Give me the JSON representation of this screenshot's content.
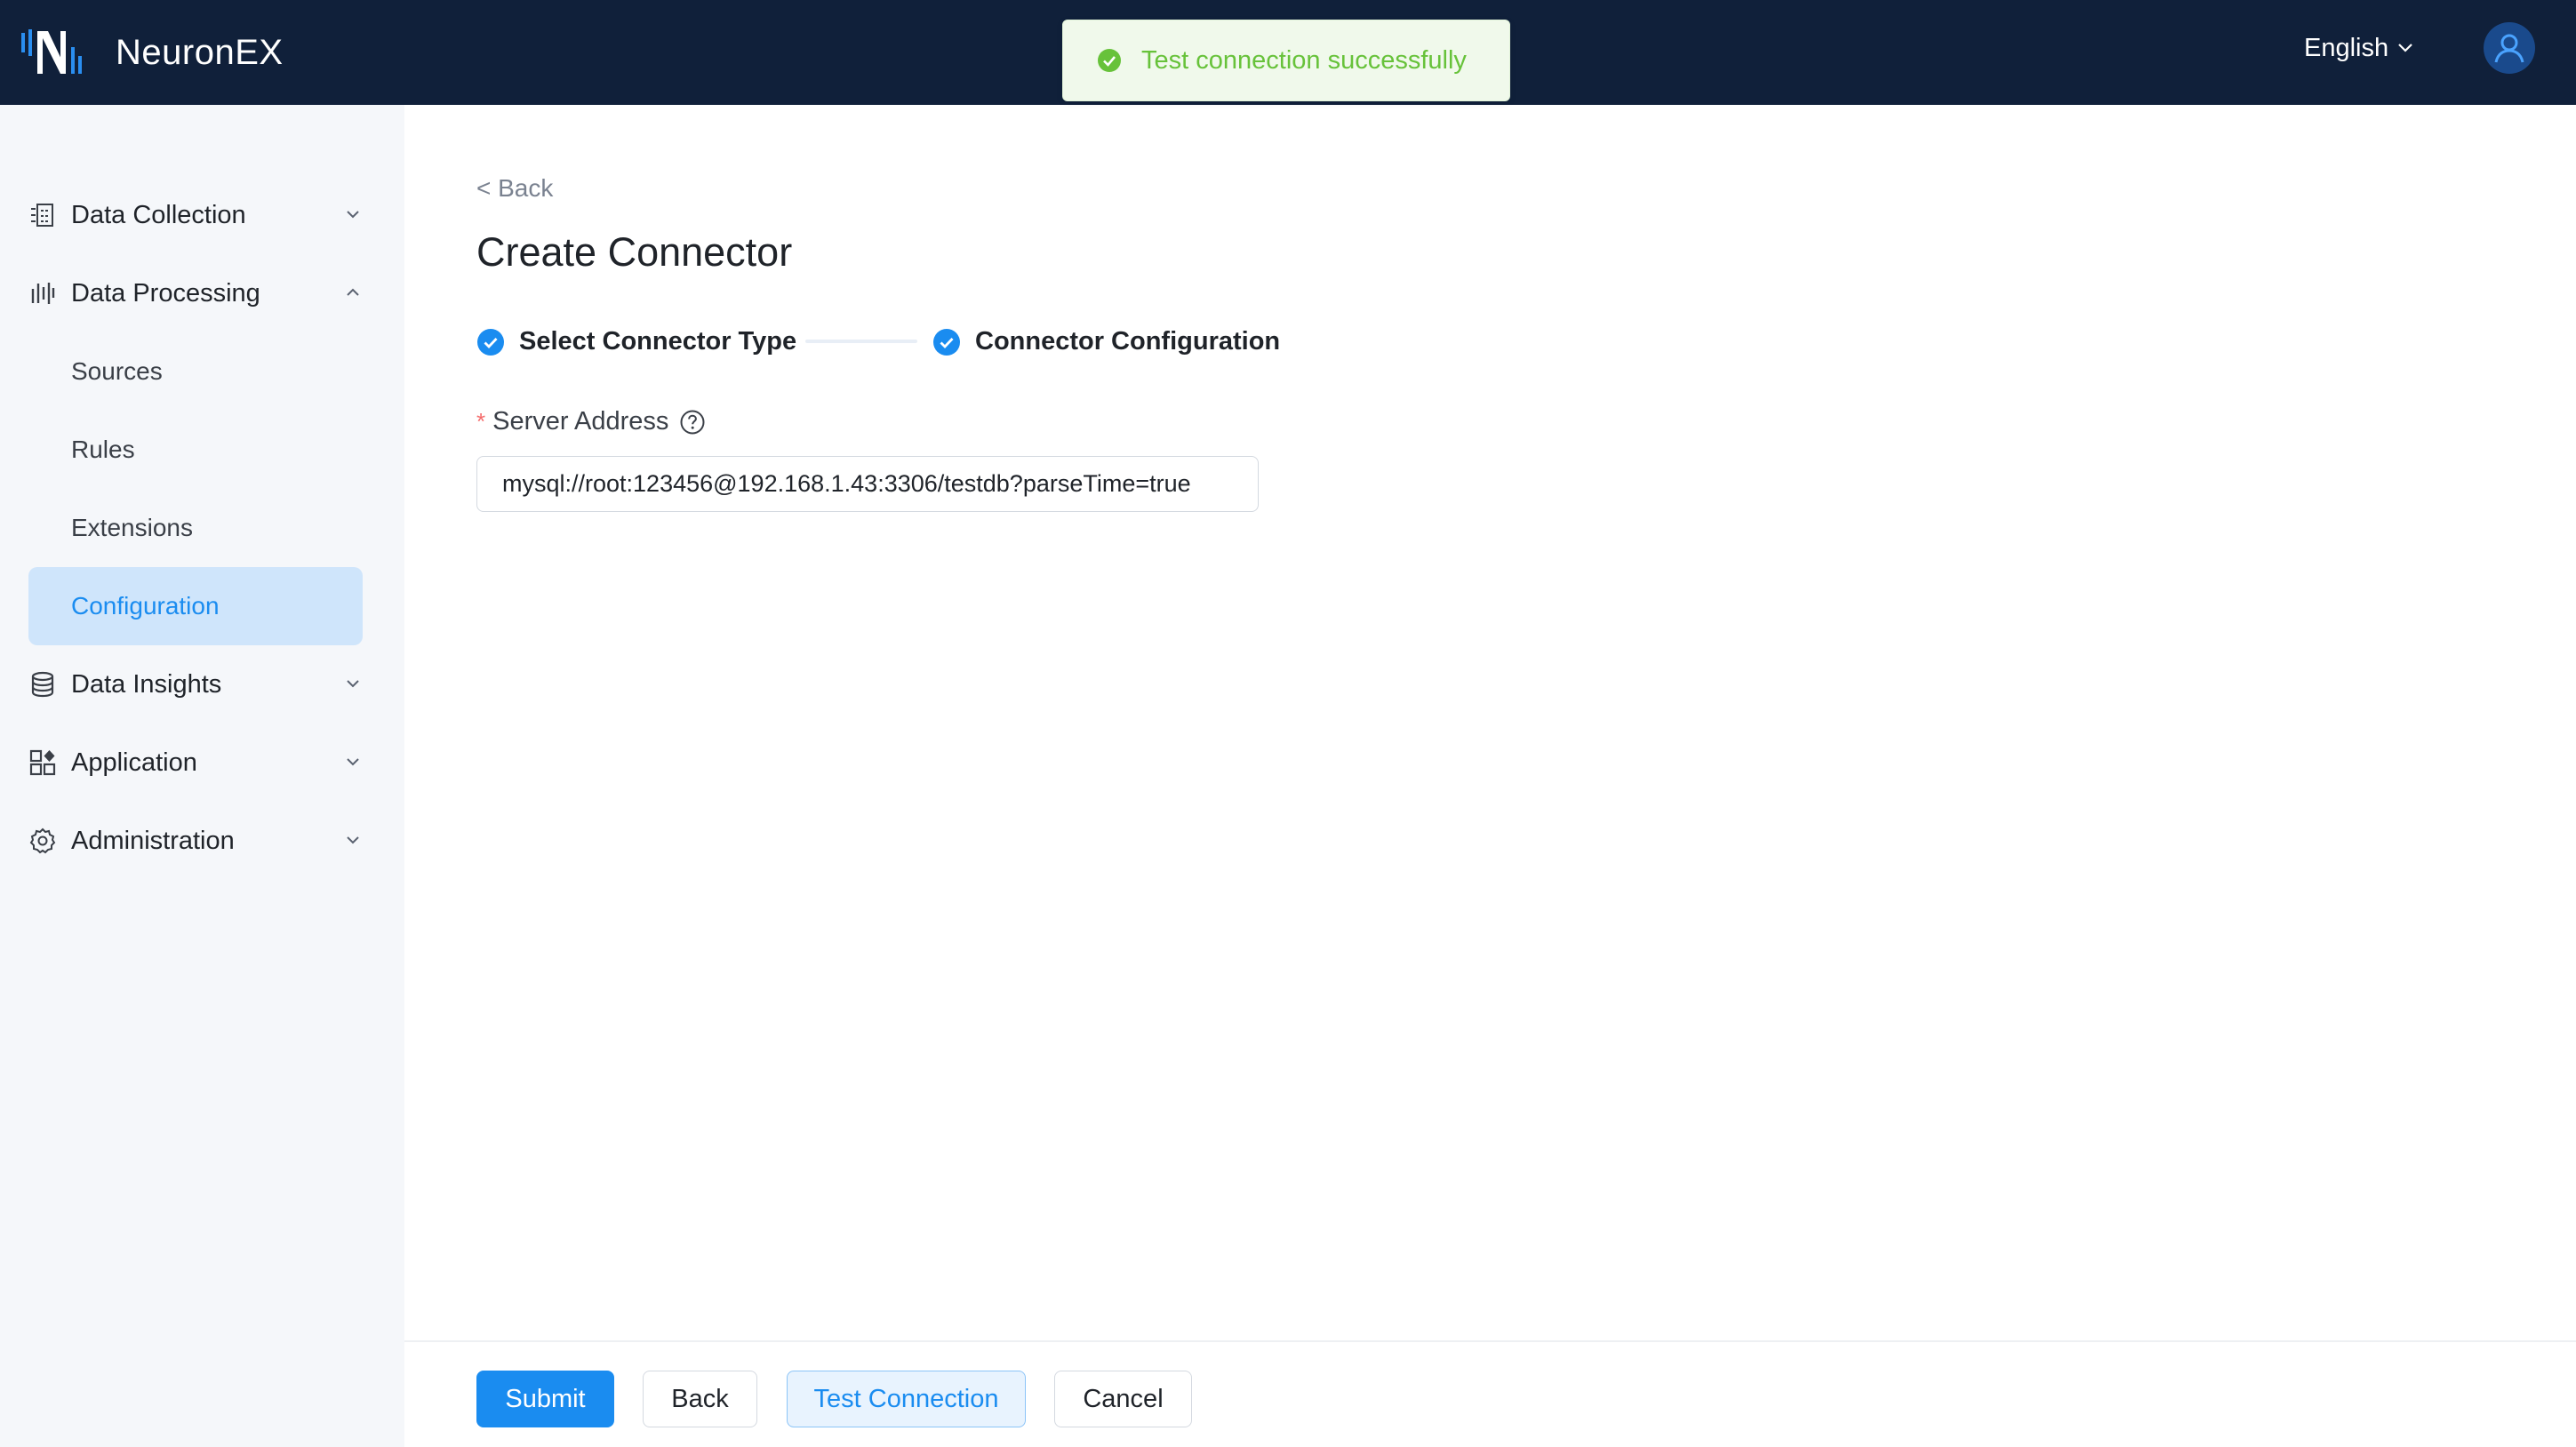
{
  "app": {
    "name": "NeuronEX"
  },
  "header": {
    "language": "English"
  },
  "toast": {
    "message": "Test connection successfully"
  },
  "sidebar": {
    "items": [
      {
        "label": "Data Collection",
        "expanded": false
      },
      {
        "label": "Data Processing",
        "expanded": true,
        "children": [
          "Sources",
          "Rules",
          "Extensions",
          "Configuration"
        ],
        "active_child": "Configuration"
      },
      {
        "label": "Data Insights",
        "expanded": false
      },
      {
        "label": "Application",
        "expanded": false
      },
      {
        "label": "Administration",
        "expanded": false
      }
    ]
  },
  "main": {
    "back_label": "< Back",
    "title": "Create Connector",
    "steps": [
      {
        "label": "Select Connector Type",
        "status": "done"
      },
      {
        "label": "Connector Configuration",
        "status": "done"
      }
    ],
    "form": {
      "server_address": {
        "label": "Server Address",
        "required": true,
        "value": "mysql://root:123456@192.168.1.43:3306/testdb?parseTime=true"
      }
    }
  },
  "footer": {
    "submit_label": "Submit",
    "back_label": "Back",
    "test_label": "Test Connection",
    "cancel_label": "Cancel"
  },
  "colors": {
    "header_bg": "#10203a",
    "accent": "#1a8cf0",
    "success": "#67c23a",
    "sidebar_bg": "#f5f7fa",
    "active_item_bg": "#cfe5fb"
  }
}
